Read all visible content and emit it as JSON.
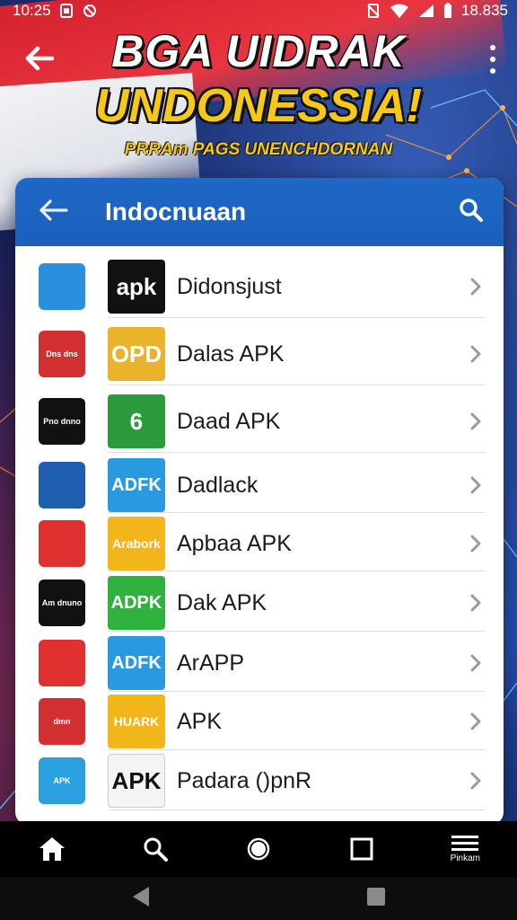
{
  "status_bar": {
    "time": "10:25",
    "battery_text": "18.835"
  },
  "banner": {
    "title_line1": "BGA UIDRAK",
    "title_line2": "UNDONESSIA!",
    "subtitle": "PRRAm PAGS UNENCHDORNAN"
  },
  "panel": {
    "title": "Indocnuaan"
  },
  "apps": [
    {
      "name": "Didonsjust",
      "badge_text": "apk",
      "badge_color": "#111111",
      "icon_color": "#2a8fdf",
      "icon_text": ""
    },
    {
      "name": "Dalas APK",
      "badge_text": "OPD",
      "badge_color": "#e9b42a",
      "icon_color": "#d23030",
      "icon_text": "Dns dns"
    },
    {
      "name": "Daad APK",
      "badge_text": "6",
      "badge_color": "#2a9a3a",
      "icon_color": "#111111",
      "icon_text": "Pno dnno"
    },
    {
      "name": "Dadlack",
      "badge_text": "ADFK",
      "badge_color": "#2a9ae0",
      "icon_color": "#1f5fb0",
      "icon_text": ""
    },
    {
      "name": "Apbaa APK",
      "badge_text": "Arabork",
      "badge_color": "#f2b51a",
      "icon_color": "#e03030",
      "icon_text": ""
    },
    {
      "name": "Dak APK",
      "badge_text": "ADPK",
      "badge_color": "#2fb33e",
      "icon_color": "#111111",
      "icon_text": "Am dnuno"
    },
    {
      "name": "ArAPP",
      "badge_text": "ADFK",
      "badge_color": "#2a9ae0",
      "icon_color": "#e03030",
      "icon_text": ""
    },
    {
      "name": "APK",
      "badge_text": "HUARK",
      "badge_color": "#f2b51a",
      "icon_color": "#d23030",
      "icon_text": "dmn"
    },
    {
      "name": "Padara ()pnR",
      "badge_text": "APK",
      "badge_color": "#f4f4f4",
      "icon_color": "#2aa0e0",
      "icon_text": "APK"
    }
  ],
  "nav": {
    "items": [
      {
        "icon": "home-icon"
      },
      {
        "icon": "search-icon"
      },
      {
        "icon": "circle-icon"
      },
      {
        "icon": "square-icon"
      },
      {
        "icon": "menu-icon",
        "label": "Pinkam"
      }
    ]
  }
}
